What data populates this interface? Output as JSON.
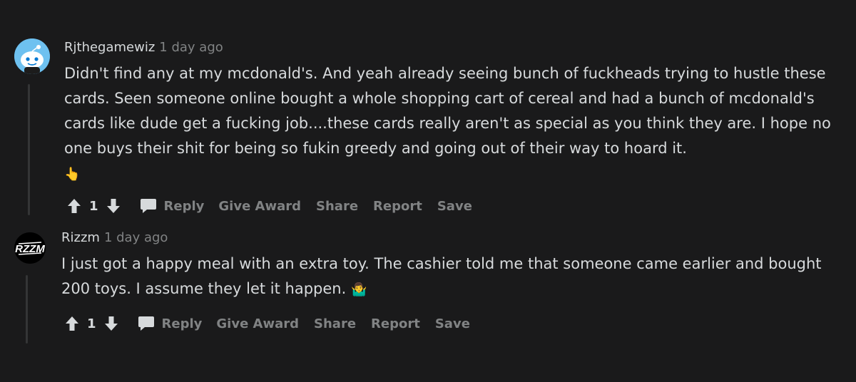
{
  "comments": [
    {
      "author": "Rjthegamewiz",
      "time": "1 day ago",
      "avatar_icon": "reddit-snoo-icon",
      "body": "Didn't find any at my mcdonald's. And yeah already seeing bunch of fuckheads trying to hustle these cards. Seen someone online bought a whole shopping cart of cereal and had a bunch of mcdonald's cards like dude get a fucking job....these cards really aren't as special as you think they are. I hope no one buys their shit for being so fukin greedy and going out of their way to hoard it.",
      "emoji": "👆",
      "score": "1",
      "actions": {
        "reply": "Reply",
        "give_award": "Give Award",
        "share": "Share",
        "report": "Report",
        "save": "Save"
      }
    },
    {
      "author": "Rizzm",
      "time": "1 day ago",
      "avatar_icon": "rizzm-logo-icon",
      "body": "I just got a happy meal with an extra toy. The cashier told me that someone came earlier and bought 200 toys. I assume they let it happen.",
      "emoji": "🤷‍♂️",
      "score": "1",
      "actions": {
        "reply": "Reply",
        "give_award": "Give Award",
        "share": "Share",
        "report": "Report",
        "save": "Save"
      }
    }
  ],
  "colors": {
    "background": "#1a1a1b",
    "text": "#d7dadc",
    "muted": "#818384",
    "thread_line": "#343536",
    "snoo_blue": "#0079d3"
  }
}
